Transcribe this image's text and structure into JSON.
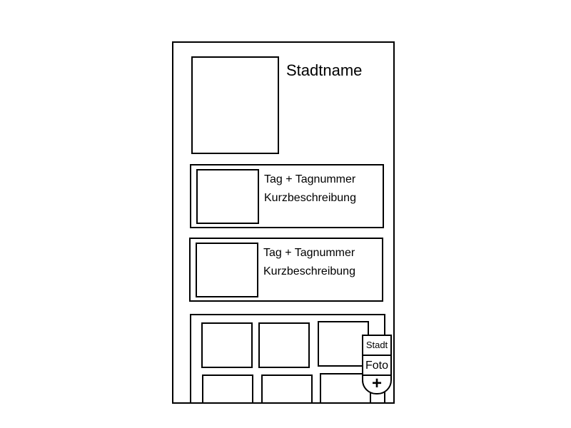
{
  "header": {
    "city_name": "Stadtname"
  },
  "days": [
    {
      "title": "Tag + Tagnummer",
      "description": "Kurzbeschreibung"
    },
    {
      "title": "Tag + Tagnummer",
      "description": "Kurzbeschreibung"
    }
  ],
  "fab_menu": {
    "city_label": "Stadt",
    "photo_label": "Foto",
    "add_symbol": "+"
  }
}
